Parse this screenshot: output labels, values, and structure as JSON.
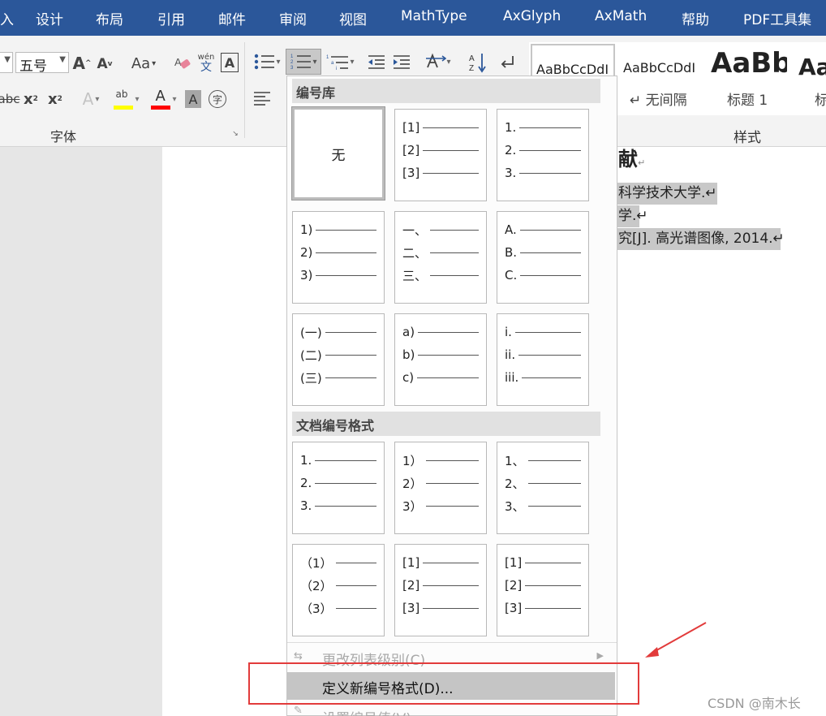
{
  "tabs": [
    "入",
    "设计",
    "布局",
    "引用",
    "邮件",
    "审阅",
    "视图",
    "MathType",
    "AxGlyph",
    "AxMath",
    "帮助",
    "PDF工具集"
  ],
  "ribbon": {
    "font_size": "五号",
    "grow_font": "A",
    "shrink_font": "A",
    "change_case": "Aa",
    "phonetic_top": "wén",
    "phonetic_bottom": "文",
    "char_border": "A",
    "strike": "abc",
    "subscript": "x",
    "superscript": "x",
    "text_effect": "A",
    "highlight": "ab",
    "font_color": "A",
    "char_shading": "A",
    "enclose": "字",
    "group_font_label": "字体",
    "group_styles_label": "样式"
  },
  "styles": {
    "items": [
      {
        "preview": "AaBbCcDdI",
        "name": ""
      },
      {
        "preview": "AaBbCcDdI",
        "name": "↵ 无间隔"
      },
      {
        "preview": "AaBb",
        "name": "标题 1"
      },
      {
        "preview": "Aa",
        "name": "标"
      }
    ]
  },
  "document": {
    "heading": "献",
    "heading_mark": "↵",
    "lines": [
      "科学技术大学.↵",
      "学.↵",
      "究[J].  高光谱图像, 2014.↵"
    ]
  },
  "menu": {
    "library_header": "编号库",
    "none_label": "无",
    "library": [
      [
        "[1]",
        "[2]",
        "[3]"
      ],
      [
        "1.",
        "2.",
        "3."
      ],
      [
        "1)",
        "2)",
        "3)"
      ],
      [
        "一、",
        "二、",
        "三、"
      ],
      [
        "A.",
        "B.",
        "C."
      ],
      [
        "(一)",
        "(二)",
        "(三)"
      ],
      [
        "a)",
        "b)",
        "c)"
      ],
      [
        "i.",
        "ii.",
        "iii."
      ]
    ],
    "doc_header": "文档编号格式",
    "doc_formats": [
      [
        "1.",
        "2.",
        "3."
      ],
      [
        "1）",
        "2）",
        "3）"
      ],
      [
        "1、",
        "2、",
        "3、"
      ],
      [
        "（1）",
        "（2）",
        "（3）"
      ],
      [
        "[1]",
        "[2]",
        "[3]"
      ],
      [
        "[1]",
        "[2]",
        "[3]"
      ]
    ],
    "change_level": "更改列表级别(C)",
    "define_new": "定义新编号格式(D)...",
    "set_value": "设置编号值(V)..."
  },
  "watermark": "CSDN @南木长",
  "colors": {
    "tab_bar": "#2b579a",
    "highlight_bar": "#ffff00",
    "font_color_bar": "#ff0000",
    "annotation": "#e23b3b"
  }
}
